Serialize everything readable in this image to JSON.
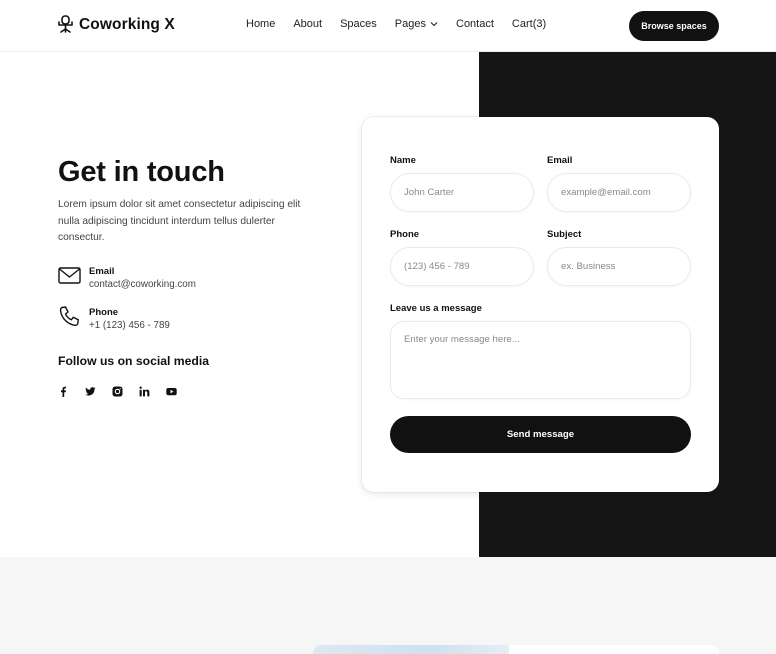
{
  "header": {
    "logo_text": "Coworking X",
    "nav": [
      {
        "label": "Home"
      },
      {
        "label": "About"
      },
      {
        "label": "Spaces"
      },
      {
        "label": "Pages"
      },
      {
        "label": "Contact"
      },
      {
        "label": "Cart(3)"
      }
    ],
    "cta_label": "Browse spaces"
  },
  "contact": {
    "title": "Get in touch",
    "description": "Lorem ipsum dolor sit amet consectetur adipiscing elit nulla adipiscing tincidunt interdum tellus dulerter consectur.",
    "email_label": "Email",
    "email_value": "contact@coworking.com",
    "phone_label": "Phone",
    "phone_value": "+1 (123) 456 - 789",
    "follow_title": "Follow us on social media",
    "socials": [
      "facebook-icon",
      "twitter-icon",
      "instagram-icon",
      "linkedin-icon",
      "youtube-icon"
    ]
  },
  "form": {
    "name_label": "Name",
    "name_placeholder": "John Carter",
    "email_label": "Email",
    "email_placeholder": "example@email.com",
    "phone_label": "Phone",
    "phone_placeholder": "(123) 456 - 789",
    "subject_label": "Subject",
    "subject_placeholder": "ex. Business",
    "message_label": "Leave us a message",
    "message_placeholder": "Enter your message here...",
    "submit_label": "Send message"
  },
  "colors": {
    "accent": "#111111",
    "dark_panel": "#151515",
    "bottom_bg": "#f6f6f6"
  }
}
